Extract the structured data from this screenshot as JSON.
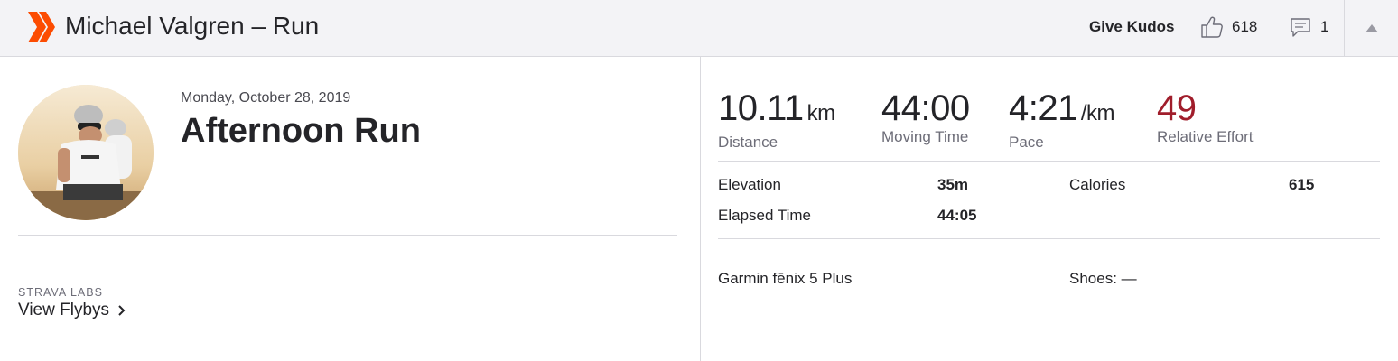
{
  "header": {
    "title": "Michael Valgren – Run",
    "give_kudos": "Give Kudos",
    "kudos_count": "618",
    "comment_count": "1",
    "brand_color": "#fc4c02"
  },
  "activity": {
    "date": "Monday, October 28, 2019",
    "name": "Afternoon Run"
  },
  "labs": {
    "label": "STRAVA LABS",
    "link": "View Flybys"
  },
  "stats": {
    "distance": {
      "value": "10.11",
      "unit": "km",
      "label": "Distance"
    },
    "moving_time": {
      "value": "44:00",
      "label": "Moving Time"
    },
    "pace": {
      "value": "4:21",
      "unit": "/km",
      "label": "Pace"
    },
    "relative_effort": {
      "value": "49",
      "label": "Relative Effort",
      "color": "#a01d2b"
    }
  },
  "details": {
    "elevation_label": "Elevation",
    "elevation_value": "35m",
    "calories_label": "Calories",
    "calories_value": "615",
    "elapsed_label": "Elapsed Time",
    "elapsed_value": "44:05"
  },
  "gear": {
    "device": "Garmin fēnix 5 Plus",
    "shoes": "Shoes: —"
  }
}
